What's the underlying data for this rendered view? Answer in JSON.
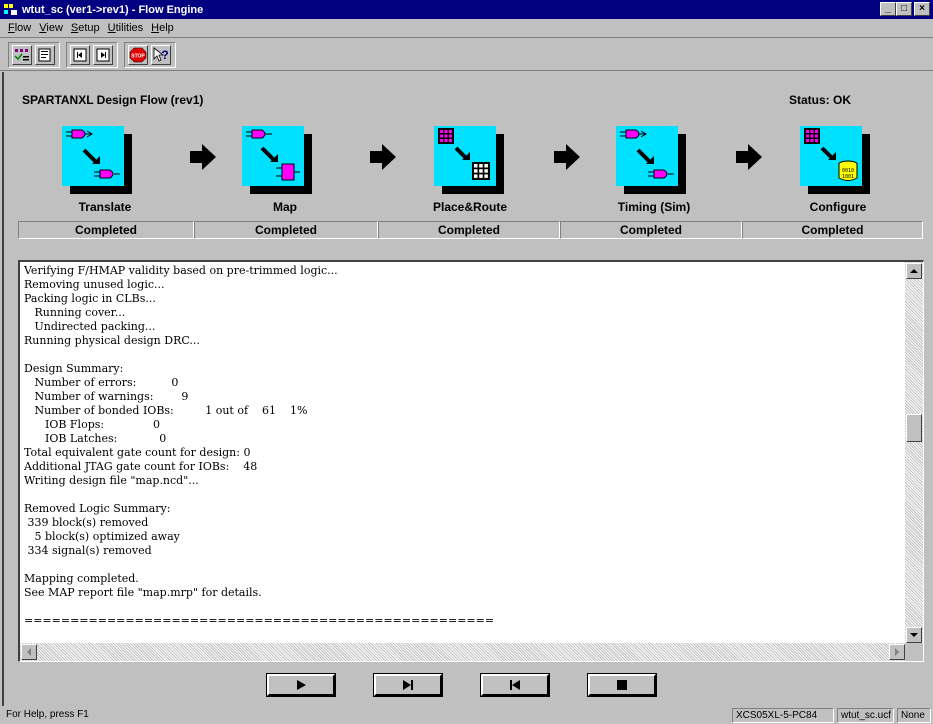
{
  "window": {
    "title": "wtut_sc (ver1->rev1) - Flow Engine",
    "controls": [
      "minimize-icon",
      "maximize-icon",
      "close-icon"
    ]
  },
  "menu": [
    {
      "label": "Flow",
      "key": "F"
    },
    {
      "label": "View",
      "key": "V"
    },
    {
      "label": "Setup",
      "key": "S"
    },
    {
      "label": "Utilities",
      "key": "U"
    },
    {
      "label": "Help",
      "key": "H"
    }
  ],
  "toolbar": {
    "buttons": [
      "flow-options-icon",
      "report-icon",
      "step-back-icon",
      "step-forward-icon",
      "stop-icon",
      "context-help-icon"
    ]
  },
  "flow": {
    "title": "SPARTANXL Design Flow (rev1)",
    "status": "Status: OK",
    "steps": [
      {
        "label": "Translate",
        "status": "Completed",
        "icon": "translate-icon"
      },
      {
        "label": "Map",
        "status": "Completed",
        "icon": "map-icon"
      },
      {
        "label": "Place&Route",
        "status": "Completed",
        "icon": "place-route-icon"
      },
      {
        "label": "Timing (Sim)",
        "status": "Completed",
        "icon": "timing-icon"
      },
      {
        "label": "Configure",
        "status": "Completed",
        "icon": "configure-icon"
      }
    ]
  },
  "log": {
    "lines": [
      "Verifying F/HMAP validity based on pre-trimmed logic...",
      "Removing unused logic...",
      "Packing logic in CLBs...",
      "   Running cover...",
      "   Undirected packing...",
      "Running physical design DRC...",
      "",
      "Design Summary:",
      "   Number of errors:          0",
      "   Number of warnings:        9",
      "   Number of bonded IOBs:         1 out of    61    1%",
      "      IOB Flops:              0",
      "      IOB Latches:            0",
      "Total equivalent gate count for design: 0",
      "Additional JTAG gate count for IOBs:    48",
      "Writing design file \"map.ncd\"...",
      "",
      "Removed Logic Summary:",
      " 339 block(s) removed",
      "   5 block(s) optimized away",
      " 334 signal(s) removed",
      "",
      "Mapping completed.",
      "See MAP report file \"map.mrp\" for details.",
      "",
      "==================================================="
    ]
  },
  "transport": [
    "play-icon",
    "step-icon",
    "rewind-icon",
    "stop-square-icon"
  ],
  "statusbar": {
    "help": "For Help, press F1",
    "device": "XCS05XL-5-PC84",
    "ucf": "wtut_sc.ucf",
    "mode": "None"
  }
}
